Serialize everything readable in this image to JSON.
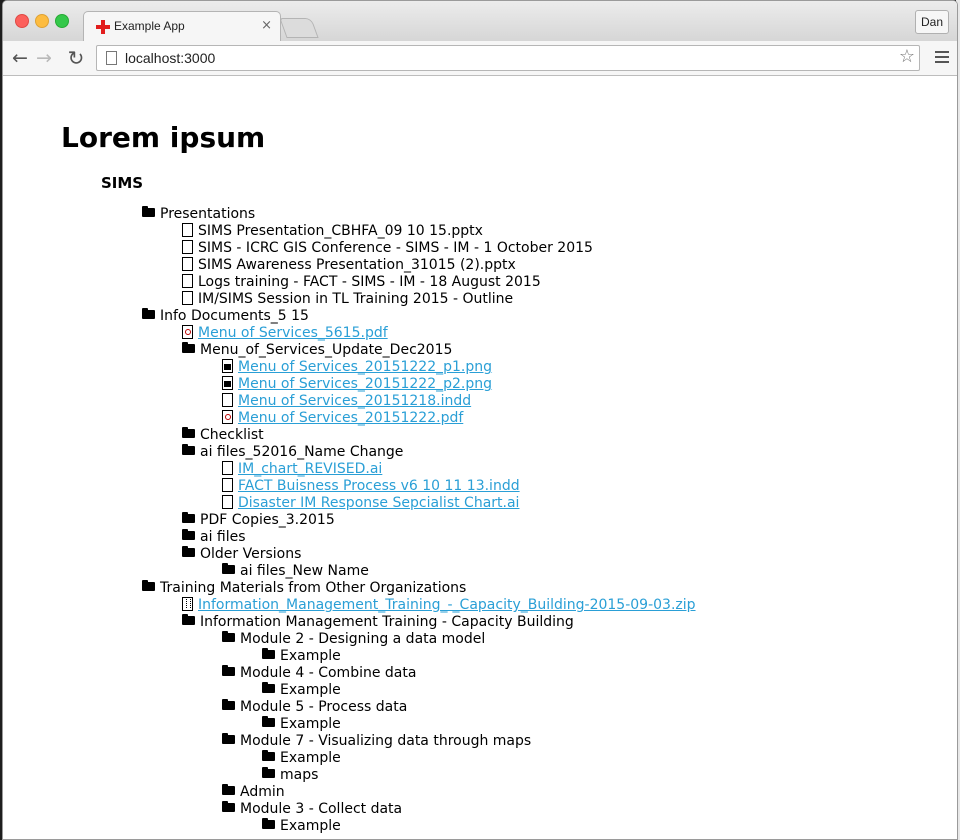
{
  "browser": {
    "tab_title": "Example App",
    "tab_close": "×",
    "profile_name": "Dan",
    "url": "localhost:3000"
  },
  "page": {
    "title": "Lorem ipsum",
    "section": "SIMS"
  },
  "tree": [
    {
      "level": 0,
      "type": "folder",
      "label": "Presentations"
    },
    {
      "level": 1,
      "type": "file",
      "label": "SIMS Presentation_CBHFA_09 10 15.pptx"
    },
    {
      "level": 1,
      "type": "file",
      "label": "SIMS - ICRC GIS Conference - SIMS - IM - 1 October 2015"
    },
    {
      "level": 1,
      "type": "file",
      "label": "SIMS Awareness Presentation_31015 (2).pptx"
    },
    {
      "level": 1,
      "type": "file",
      "label": "Logs training - FACT - SIMS - IM - 18 August 2015"
    },
    {
      "level": 1,
      "type": "file",
      "label": "IM/SIMS Session in TL Training 2015 - Outline"
    },
    {
      "level": 0,
      "type": "folder",
      "label": "Info Documents_5 15"
    },
    {
      "level": 1,
      "type": "pdf",
      "label": "Menu of Services_5615.pdf",
      "link": true
    },
    {
      "level": 1,
      "type": "folder",
      "label": "Menu_of_Services_Update_Dec2015"
    },
    {
      "level": 2,
      "type": "img",
      "label": "Menu of Services_20151222_p1.png",
      "link": true
    },
    {
      "level": 2,
      "type": "img",
      "label": "Menu of Services_20151222_p2.png",
      "link": true
    },
    {
      "level": 2,
      "type": "file",
      "label": "Menu of Services_20151218.indd",
      "link": true
    },
    {
      "level": 2,
      "type": "pdf",
      "label": "Menu of Services_20151222.pdf",
      "link": true
    },
    {
      "level": 1,
      "type": "folder",
      "label": "Checklist"
    },
    {
      "level": 1,
      "type": "folder",
      "label": "ai files_52016_Name Change"
    },
    {
      "level": 2,
      "type": "file",
      "label": "IM_chart_REVISED.ai",
      "link": true
    },
    {
      "level": 2,
      "type": "file",
      "label": "FACT Buisness Process v6 10 11 13.indd",
      "link": true
    },
    {
      "level": 2,
      "type": "file",
      "label": "Disaster IM Response Sepcialist Chart.ai",
      "link": true
    },
    {
      "level": 1,
      "type": "folder",
      "label": "PDF Copies_3.2015"
    },
    {
      "level": 1,
      "type": "folder",
      "label": "ai files"
    },
    {
      "level": 1,
      "type": "folder",
      "label": "Older Versions"
    },
    {
      "level": 2,
      "type": "folder",
      "label": "ai files_New Name"
    },
    {
      "level": 0,
      "type": "folder",
      "label": "Training Materials from Other Organizations"
    },
    {
      "level": 1,
      "type": "zip",
      "label": "Information_Management_Training_-_Capacity_Building-2015-09-03.zip",
      "link": true
    },
    {
      "level": 1,
      "type": "folder",
      "label": "Information Management Training - Capacity Building"
    },
    {
      "level": 2,
      "type": "folder",
      "label": "Module 2 - Designing a data model"
    },
    {
      "level": 3,
      "type": "folder",
      "label": "Example"
    },
    {
      "level": 2,
      "type": "folder",
      "label": "Module 4 - Combine data"
    },
    {
      "level": 3,
      "type": "folder",
      "label": "Example"
    },
    {
      "level": 2,
      "type": "folder",
      "label": "Module 5 - Process data"
    },
    {
      "level": 3,
      "type": "folder",
      "label": "Example"
    },
    {
      "level": 2,
      "type": "folder",
      "label": "Module 7 - Visualizing data through maps"
    },
    {
      "level": 3,
      "type": "folder",
      "label": "Example"
    },
    {
      "level": 3,
      "type": "folder",
      "label": "maps"
    },
    {
      "level": 2,
      "type": "folder",
      "label": "Admin"
    },
    {
      "level": 2,
      "type": "folder",
      "label": "Module 3 - Collect data"
    },
    {
      "level": 3,
      "type": "folder",
      "label": "Example"
    }
  ],
  "colors": {
    "link": "#2a9fd6",
    "close": "#fc605c",
    "minimize": "#fdbc40",
    "maximize": "#34c84a"
  }
}
